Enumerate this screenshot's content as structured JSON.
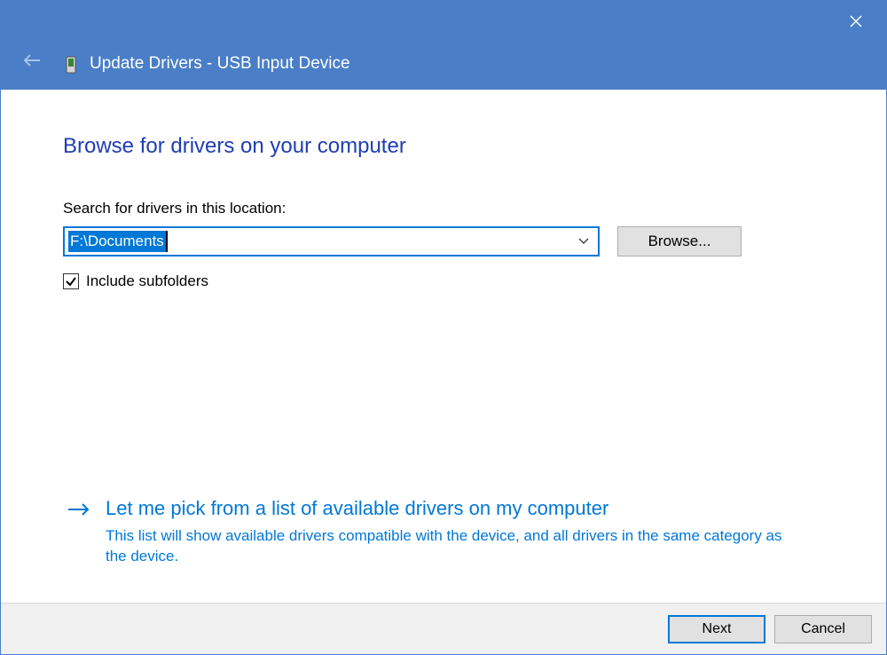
{
  "window": {
    "title": "Update Drivers - USB Input Device"
  },
  "main": {
    "heading": "Browse for drivers on your computer",
    "search_label": "Search for drivers in this location:",
    "path_value": "F:\\Documents",
    "browse_label": "Browse...",
    "include_subfolders_label": "Include subfolders",
    "include_subfolders_checked": true
  },
  "option": {
    "title": "Let me pick from a list of available drivers on my computer",
    "description": "This list will show available drivers compatible with the device, and all drivers in the same category as the device."
  },
  "footer": {
    "next_label": "Next",
    "cancel_label": "Cancel"
  },
  "colors": {
    "titlebar": "#4a7ec7",
    "accent": "#0078d7",
    "heading": "#1f3db5"
  }
}
